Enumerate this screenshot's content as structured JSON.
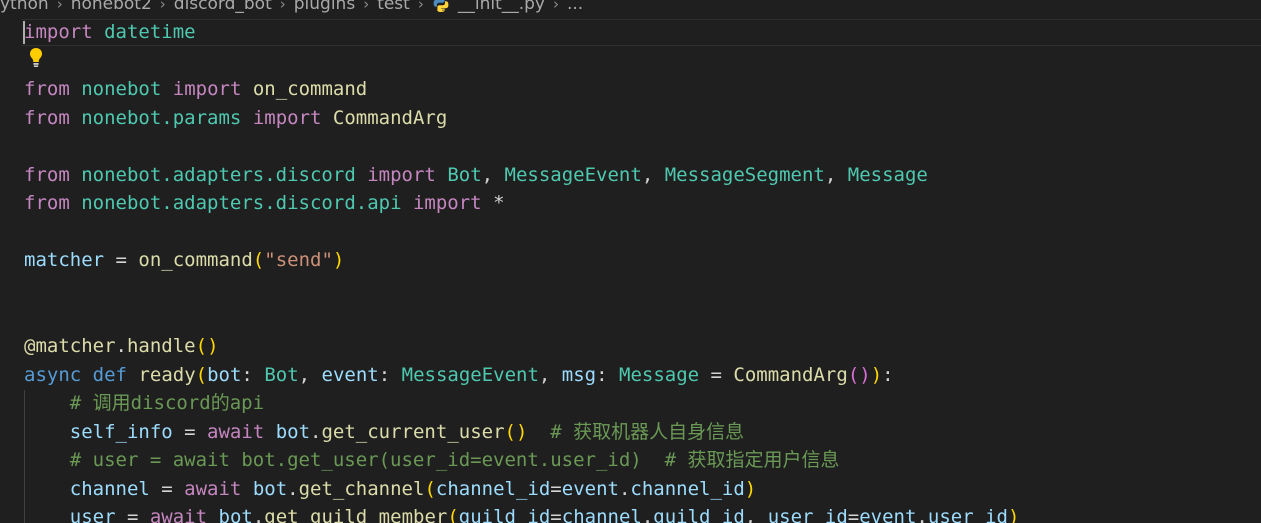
{
  "breadcrumb": {
    "items": [
      "ython",
      "nonebot2",
      "discord_bot",
      "plugins",
      "test"
    ],
    "file": "__init__.py",
    "ellipsis": "...",
    "separator": "›"
  },
  "code": {
    "l1": {
      "kw": "import",
      "mod": "datetime"
    },
    "l3": {
      "kw1": "from",
      "mod": "nonebot",
      "kw2": "import",
      "name": "on_command"
    },
    "l4": {
      "kw1": "from",
      "mod": "nonebot.params",
      "kw2": "import",
      "name": "CommandArg"
    },
    "l6": {
      "kw1": "from",
      "mod": "nonebot.adapters.discord",
      "kw2": "import",
      "n1": "Bot",
      "n2": "MessageEvent",
      "n3": "MessageSegment",
      "n4": "Message"
    },
    "l7": {
      "kw1": "from",
      "mod": "nonebot.adapters.discord.api",
      "kw2": "import",
      "star": "*"
    },
    "l9": {
      "var": "matcher",
      "fn": "on_command",
      "str": "\"send\""
    },
    "l12": {
      "at": "@",
      "obj": "matcher",
      "meth": "handle"
    },
    "l13": {
      "kw1": "async",
      "kw2": "def",
      "fn": "ready",
      "p1": "bot",
      "t1": "Bot",
      "p2": "event",
      "t2": "MessageEvent",
      "p3": "msg",
      "t3": "Message",
      "d3": "CommandArg"
    },
    "l14": {
      "comment": "# 调用discord的api"
    },
    "l15": {
      "var": "self_info",
      "kw": "await",
      "obj": "bot",
      "meth": "get_current_user",
      "comment": "# 获取机器人自身信息"
    },
    "l16": {
      "comment": "# user = await bot.get_user(user_id=event.user_id)  # 获取指定用户信息"
    },
    "l17": {
      "var": "channel",
      "kw": "await",
      "obj": "bot",
      "meth": "get_channel",
      "arg": "channel_id",
      "o2": "event",
      "a2": "channel_id"
    },
    "l18": {
      "var": "user",
      "kw": "await",
      "obj": "bot",
      "meth": "get_guild_member",
      "arg1": "guild_id",
      "o1": "channel",
      "a1": "guild_id",
      "arg2": "user_id",
      "o2": "event",
      "a2": "user_id"
    }
  },
  "colors": {
    "background": "#1f1f1f",
    "keyword_control": "#c586c0",
    "keyword": "#569cd6",
    "module": "#4ec9b0",
    "function": "#dcdcaa",
    "variable": "#9cdcfe",
    "string": "#ce9178",
    "comment": "#6a9955"
  },
  "icons": {
    "file": "python-file-icon",
    "lightbulb": "lightbulb-icon"
  }
}
